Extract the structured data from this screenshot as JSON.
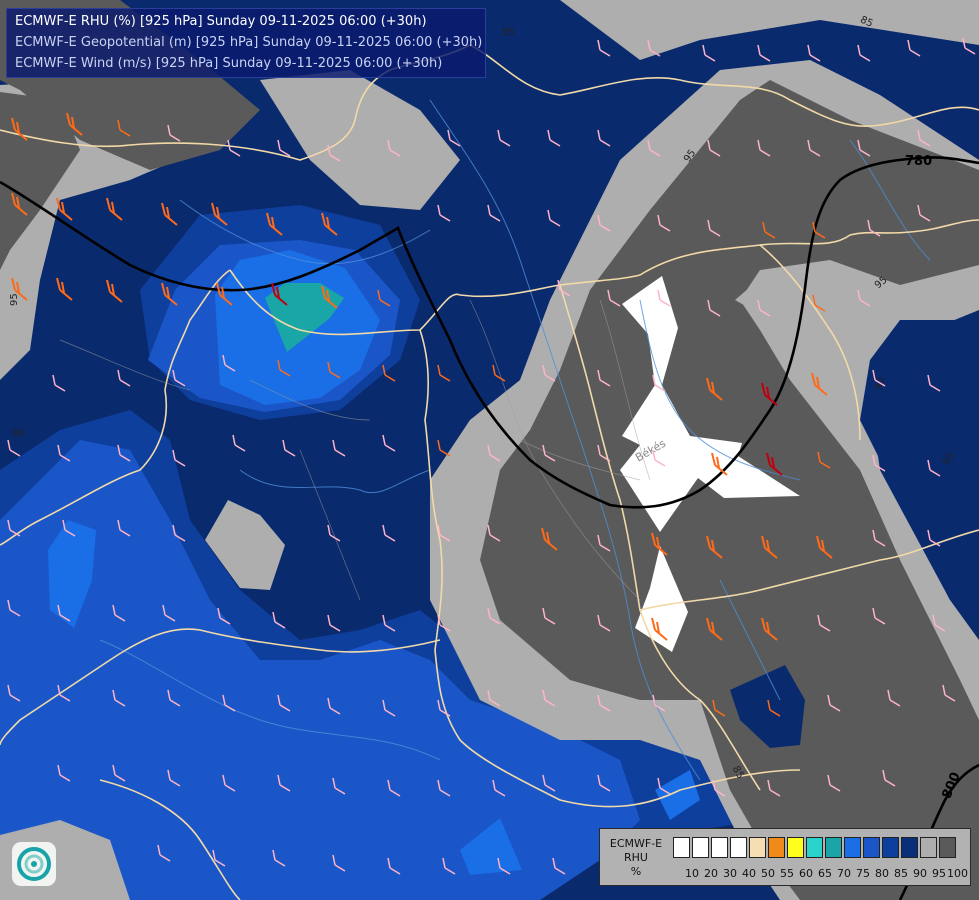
{
  "title_lines": [
    "ECMWF-E RHU (%) [925 hPa] Sunday 09-11-2025 06:00 (+30h)",
    "ECMWF-E Geopotential (m) [925 hPa] Sunday 09-11-2025 06:00 (+30h)",
    "ECMWF-E Wind (m/s) [925 hPa] Sunday 09-11-2025 06:00 (+30h)"
  ],
  "map_labels": {
    "iso_780": "780",
    "iso_800": "800",
    "c95_a": "95",
    "c95_b": "95",
    "c95_c": "95",
    "c95_d": "95",
    "c90_a": "90",
    "c90_b": "90",
    "c85_a": "85",
    "c85_b": "85",
    "c85_c": "85",
    "city_bekes": "Békés"
  },
  "legend": {
    "title_1": "ECMWF-E",
    "title_2": "RHU",
    "title_3": "%",
    "labels": [
      "10",
      "20",
      "30",
      "40",
      "50",
      "55",
      "60",
      "65",
      "70",
      "75",
      "80",
      "85",
      "90",
      "95",
      "100"
    ],
    "colors": [
      "#ffffff",
      "#ffffff",
      "#ffffff",
      "#ffffff",
      "#f6deb2",
      "#f08a1a",
      "#ffff1e",
      "#2ad2cc",
      "#1aa6a6",
      "#1a6ee6",
      "#1a56c8",
      "#0f3f9c",
      "#0a2f78",
      "#aeaeae",
      "#5a5a5a"
    ]
  },
  "colors": {
    "rhu_100": "#5a5a5a",
    "rhu_95": "#aeaeae",
    "rhu_90": "#0a2a6e",
    "rhu_85": "#0f3f9c",
    "rhu_80": "#1a56c8",
    "rhu_75": "#1a6ee6",
    "rhu_70": "#1aa6a6",
    "rhu_low": "#ffffff",
    "border": "#f1d9a8",
    "river": "#4f8fd8",
    "isohypse": "#000000"
  }
}
